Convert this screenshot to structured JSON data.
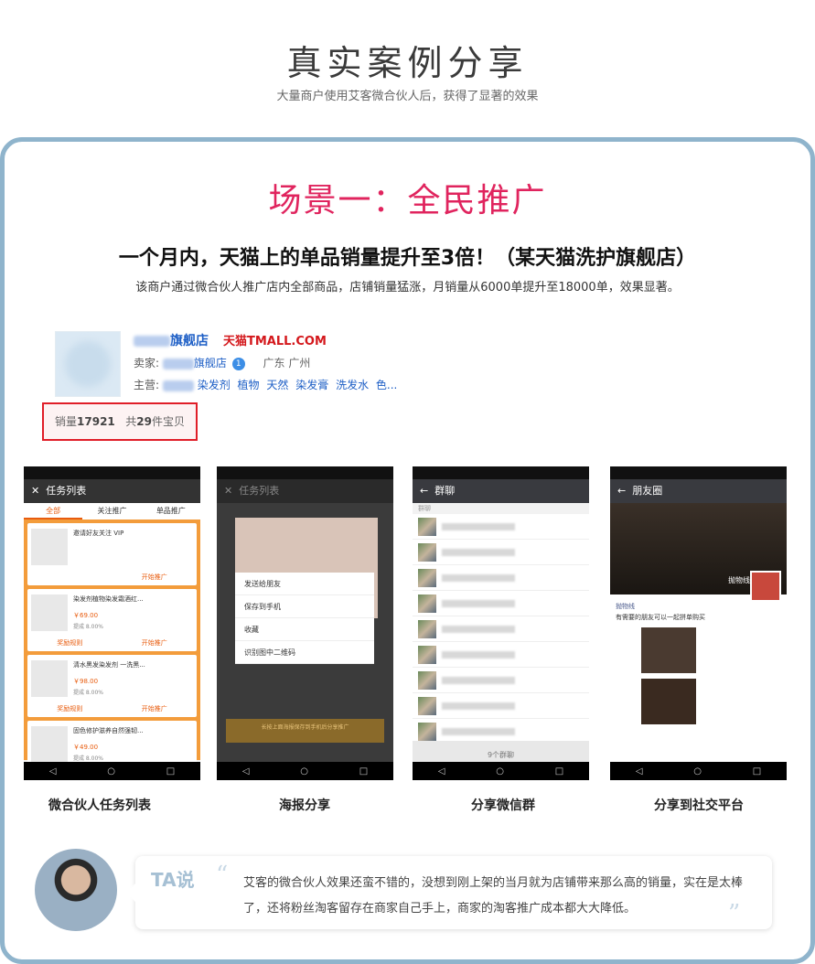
{
  "header": {
    "title": "真实案例分享",
    "subtitle": "大量商户使用艾客微合伙人后，获得了显著的效果"
  },
  "scene": {
    "title": "场景一：全民推广",
    "headline": "一个月内，天猫上的单品销量提升至3倍！（某天猫洗护旗舰店）",
    "description": "该商户通过微合伙人推广店内全部商品，店铺销量猛涨，月销量从6000单提升至18000单，效果显著。"
  },
  "shop": {
    "name_suffix": "旗舰店",
    "tmall_logo": "天猫TMALL.COM",
    "seller_label": "卖家:",
    "seller_suffix": "旗舰店",
    "region": "广东 广州",
    "main_label": "主营:",
    "main_tags": [
      "染发剂",
      "植物",
      "天然",
      "染发膏",
      "洗发水",
      "色..."
    ],
    "sales_label": "销量",
    "sales_value": "17921",
    "items_prefix": "共",
    "items_value": "29",
    "items_suffix": "件宝贝"
  },
  "phones": [
    {
      "caption": "微合伙人任务列表",
      "title": "任务列表",
      "tabs": [
        "全部",
        "关注推广",
        "单品推广"
      ],
      "items": [
        {
          "text": "邀请好友关注 VIP",
          "price": "",
          "rate": "",
          "left": "",
          "right": "开始推广"
        },
        {
          "text": "染发剂植物染发霜酒红...",
          "price": "￥69.00",
          "rate": "提成 8.00%",
          "left": "奖励规则",
          "right": "开始推广"
        },
        {
          "text": "清水黑发染发剂 一洗黑...",
          "price": "￥98.00",
          "rate": "提成 8.00%",
          "left": "奖励规则",
          "right": "开始推广"
        },
        {
          "text": "固色修护滋养自然强韧...",
          "price": "￥49.00",
          "rate": "提成 8.00%",
          "left": "",
          "right": ""
        }
      ]
    },
    {
      "caption": "海报分享",
      "title": "任务列表",
      "menu": [
        "发送给朋友",
        "保存到手机",
        "收藏",
        "识别图中二维码"
      ],
      "banner": "长按上面海报保存到手机后分享推广"
    },
    {
      "caption": "分享微信群",
      "title": "群聊",
      "section": "群聊",
      "count": "9个群聊"
    },
    {
      "caption": "分享到社交平台",
      "title": "朋友圈",
      "poster_name": "抛物线",
      "post_text": "有需要的朋友可以一起拼单购买"
    }
  ],
  "testimonial": {
    "label": "TA说",
    "open_quote": "“",
    "close_quote": "”",
    "text": "艾客的微合伙人效果还蛮不错的，没想到刚上架的当月就为店铺带来那么高的销量，实在是太棒了，还将粉丝淘客留存在商家自己手上，商家的淘客推广成本都大大降低。"
  },
  "colors": {
    "scene_title": "#e0245e",
    "card_border": "#8fb4cc",
    "sales_border": "#e01e28",
    "link": "#1e5fc6",
    "orange": "#f39c3b"
  }
}
